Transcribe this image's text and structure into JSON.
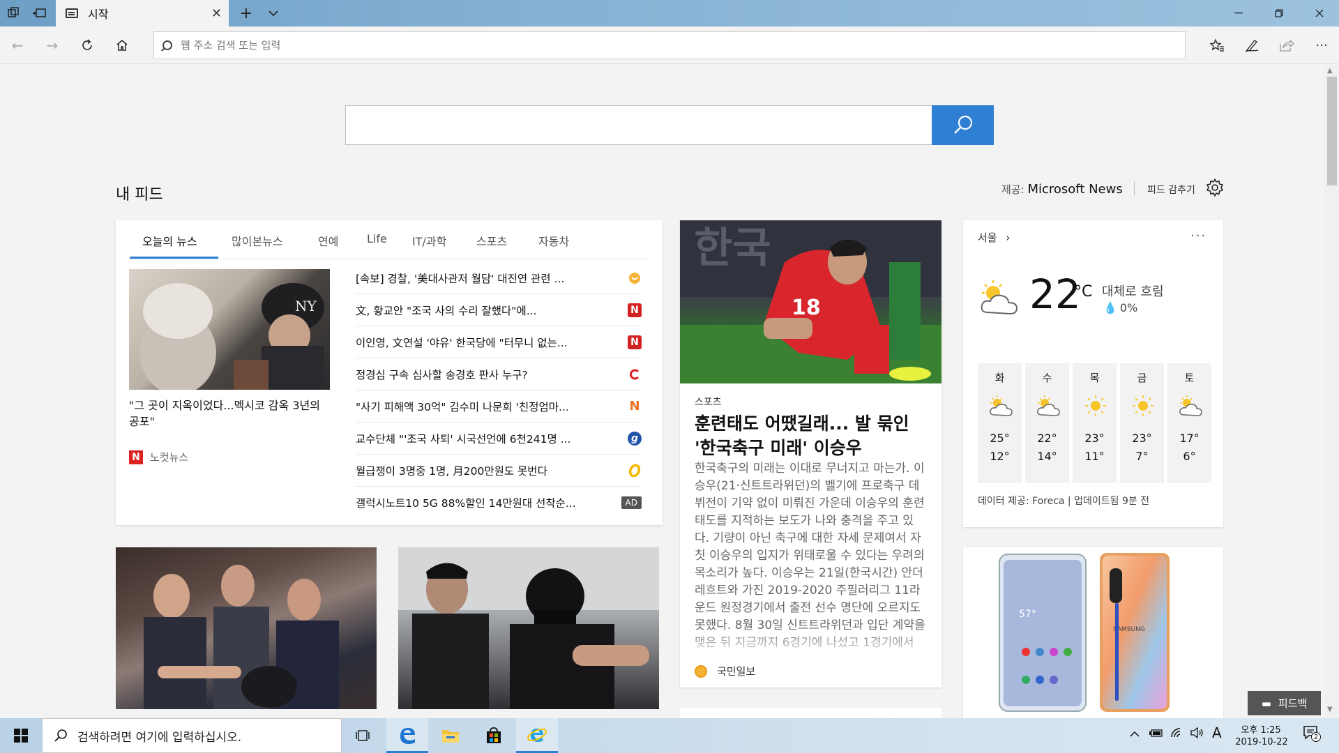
{
  "browser": {
    "tab_title": "시작",
    "address_placeholder": "웹 주소 검색 또는 입력"
  },
  "feed": {
    "title": "내 피드",
    "provider_label": "제공:",
    "provider_name": "Microsoft News",
    "hide_label": "피드 감추기",
    "tabs": [
      "오늘의 뉴스",
      "많이본뉴스",
      "연예",
      "Life",
      "IT/과학",
      "스포츠",
      "자동차"
    ]
  },
  "featured": {
    "title": "\"그 곳이 지옥이었다...멕시코 감옥 3년의 공포\"",
    "source": "노컷뉴스",
    "source_icon": "N"
  },
  "headlines": [
    {
      "text": "[속보] 경찰, '美대사관저 월담' 대진연 관련 ...",
      "icon_color": "#f0a030",
      "icon": "circle"
    },
    {
      "text": "文, 황교안 \"조국 사의 수리 잘했다\"에...",
      "icon_color": "#d22222",
      "icon": "N"
    },
    {
      "text": "이인영, 文연설 '야유' 한국당에 \"터무니 없는...",
      "icon_color": "#d22222",
      "icon": "N"
    },
    {
      "text": "정경심 구속 심사할 송경호 판사 누구?",
      "icon_color": "#d22222",
      "icon": "C"
    },
    {
      "text": "\"사기 피해액 30억\" 김수미 나문희 '친정엄마...",
      "icon_color": "#f07020",
      "icon": "N"
    },
    {
      "text": "교수단체 \"'조국 사퇴' 시국선언에 6천241명 ...",
      "icon_color": "#2255aa",
      "icon": "g"
    },
    {
      "text": "월급쟁이 3명중 1명, 月200만원도 못번다",
      "icon_color": "#f5b800",
      "icon": "o"
    },
    {
      "text": "갤럭시노트10 5G 88%할인 14만원대 선착순...",
      "icon": "ad",
      "ad_label": "AD"
    }
  ],
  "sports": {
    "category": "스포츠",
    "title": "훈련태도 어땠길래... 발 묶인 '한국축구 미래' 이승우",
    "body": "한국축구의 미래는 이대로 무너지고 마는가. 이승우(21·신트트라위던)의 벨기에 프로축구 데뷔전이 기약 없이 미뤄진 가운데 이승우의 훈련 태도를 지적하는 보도가 나와 충격을 주고 있다. 기량이 아닌 축구에 대한 자세 문제여서 자칫 이승우의 입지가 위태로울 수 있다는 우려의 목소리가 높다. 이승우는 21일(한국시간) 안더레흐트와 가진 2019-2020 주필러리그 11라운드 원정경기에서 출전 선수 명단에 오르지도 못했다. 8월 30일 신트트라위던과 입단 계약을 맺은 뒤 지금까지 6경기에 나섰고 1경기에서",
    "source": "국민일보",
    "jersey_number": "18"
  },
  "weather": {
    "city": "서울",
    "temp": "22",
    "unit": "°C",
    "condition": "대체로 흐림",
    "precip": "0%",
    "forecast": [
      {
        "day": "화",
        "hi": "25°",
        "lo": "12°",
        "icon": "partly-cloudy"
      },
      {
        "day": "수",
        "hi": "22°",
        "lo": "14°",
        "icon": "partly-cloudy"
      },
      {
        "day": "목",
        "hi": "23°",
        "lo": "11°",
        "icon": "sunny"
      },
      {
        "day": "금",
        "hi": "23°",
        "lo": "7°",
        "icon": "sunny"
      },
      {
        "day": "토",
        "hi": "17°",
        "lo": "6°",
        "icon": "partly-cloudy"
      }
    ],
    "credit": "데이터 제공: Foreca | 업데이트됨 9분 전"
  },
  "phone_ad": {
    "screen_time": "57°",
    "brand": "SAMSUNG"
  },
  "feedback_label": "피드백",
  "taskbar": {
    "search_placeholder": "검색하려면 여기에 입력하십시오.",
    "time": "오후 1:25",
    "date": "2019-10-22",
    "ime": "A",
    "notification_count": "2"
  }
}
